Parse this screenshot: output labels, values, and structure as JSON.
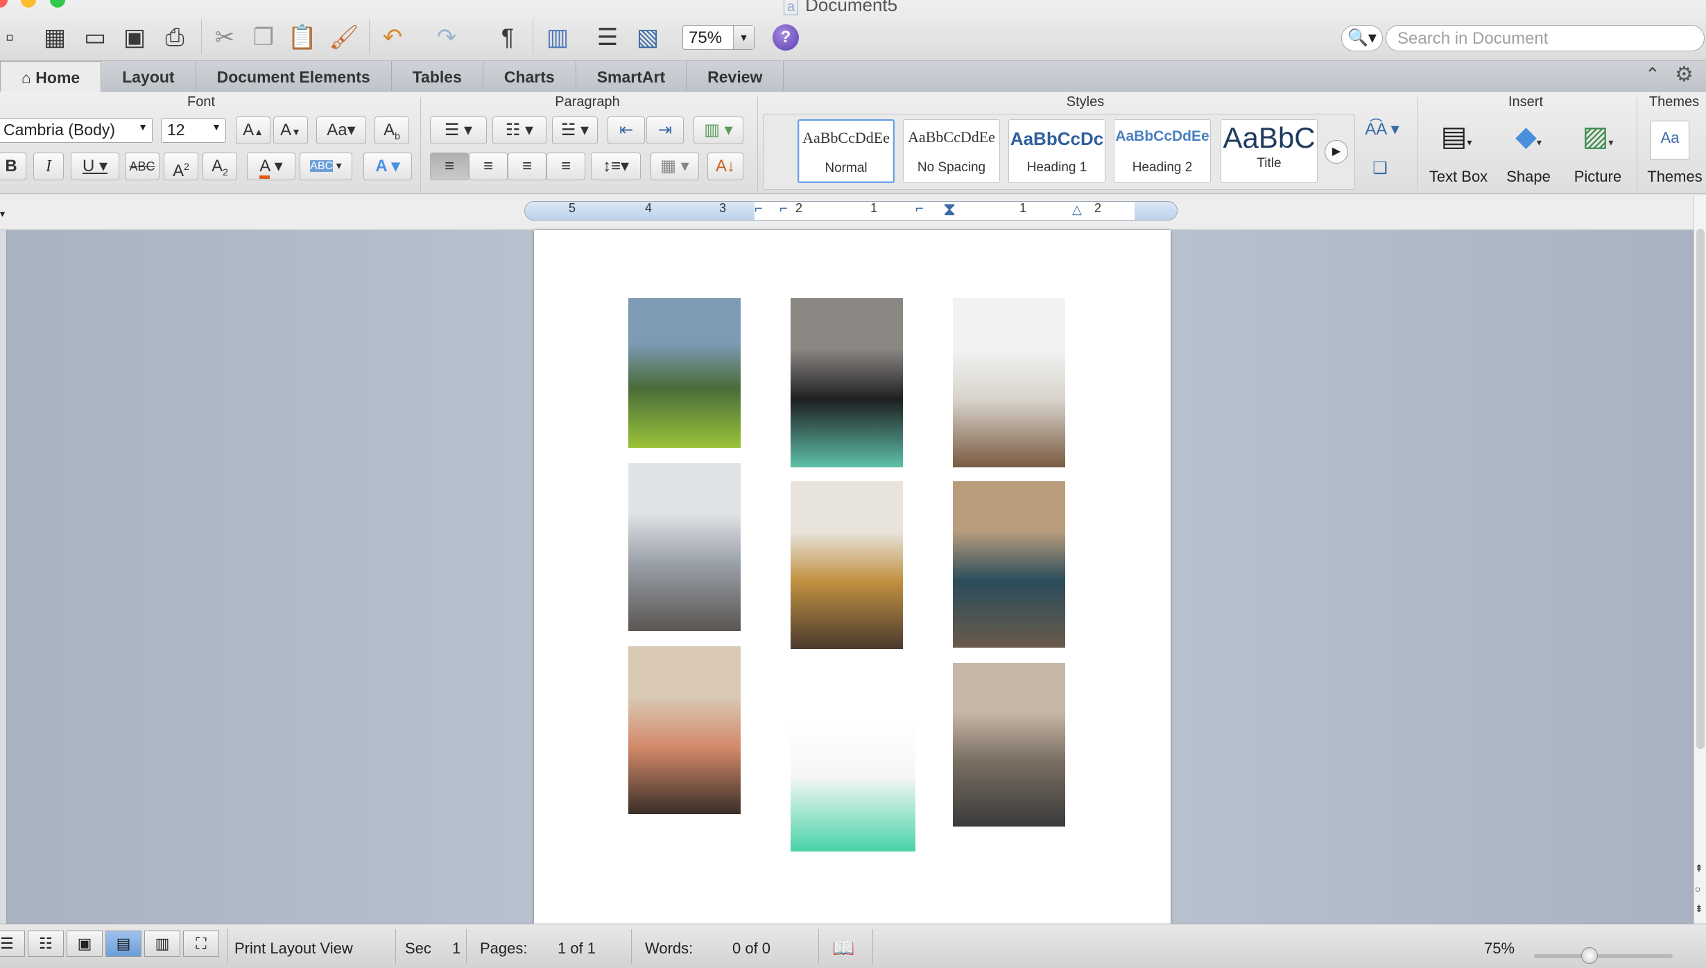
{
  "window": {
    "title": "Document5"
  },
  "toolbar": {
    "zoom": "75%",
    "search_placeholder": "Search in Document",
    "icons": [
      "new-document-icon",
      "templates-icon",
      "open-icon",
      "save-icon",
      "print-icon",
      "cut-icon",
      "copy-icon",
      "paste-icon",
      "format-painter-icon",
      "undo-icon",
      "redo-icon",
      "pilcrow-icon",
      "sidebar-icon",
      "view-icon",
      "media-browser-icon",
      "help-icon"
    ]
  },
  "ribbon": {
    "tabs": [
      "Home",
      "Layout",
      "Document Elements",
      "Tables",
      "Charts",
      "SmartArt",
      "Review"
    ],
    "active_tab": "Home",
    "groups": {
      "font": "Font",
      "paragraph": "Paragraph",
      "styles": "Styles",
      "insert": "Insert",
      "themes": "Themes"
    },
    "font_name": "Cambria (Body)",
    "font_size": "12",
    "styles": [
      {
        "sample": "AaBbCcDdEe",
        "name": "Normal"
      },
      {
        "sample": "AaBbCcDdEe",
        "name": "No Spacing"
      },
      {
        "sample": "AaBbCcDc",
        "name": "Heading 1"
      },
      {
        "sample": "AaBbCcDdEe",
        "name": "Heading 2"
      },
      {
        "sample": "AaBbC",
        "name": "Title"
      }
    ],
    "insert_items": [
      "Text Box",
      "Shape",
      "Picture"
    ],
    "themes_label": "Themes"
  },
  "ruler": {
    "numbers": [
      "5",
      "4",
      "3",
      "2",
      "1",
      "1",
      "2"
    ]
  },
  "document": {
    "photos": [
      {
        "name": "mountain-meadow-photo",
        "colors": [
          "#7d9bb5",
          "#4a6b3a",
          "#9bc43a"
        ]
      },
      {
        "name": "dog-tug-toy-photo",
        "colors": [
          "#8a8682",
          "#1f1f22",
          "#5ec0a8"
        ]
      },
      {
        "name": "chandelier-room-photo",
        "colors": [
          "#f2f2f2",
          "#d8d4cc",
          "#7a5a40"
        ]
      },
      {
        "name": "hallway-photo",
        "colors": [
          "#dfe2e6",
          "#9aa0a8",
          "#5a5552"
        ]
      },
      {
        "name": "pineapple-table-photo",
        "colors": [
          "#e8e4dc",
          "#c09040",
          "#4a3a2e"
        ]
      },
      {
        "name": "woman-wood-wall-photo",
        "colors": [
          "#b89c7c",
          "#2a4d5c",
          "#6a5a4a"
        ]
      },
      {
        "name": "two-women-table-photo",
        "colors": [
          "#d9c9b5",
          "#d48a6a",
          "#3a2e28"
        ]
      },
      {
        "name": "green-pouch-photo",
        "colors": [
          "#ffffff",
          "#f6f6f6",
          "#48d3a8"
        ]
      },
      {
        "name": "street-walk-photo",
        "colors": [
          "#c6b8a6",
          "#7a6e62",
          "#3a3a3a"
        ]
      }
    ]
  },
  "status": {
    "view_label": "Print Layout View",
    "sec_label": "Sec",
    "sec_value": "1",
    "pages_label": "Pages:",
    "pages_value": "1 of 1",
    "words_label": "Words:",
    "words_value": "0 of 0",
    "zoom": "75%"
  }
}
